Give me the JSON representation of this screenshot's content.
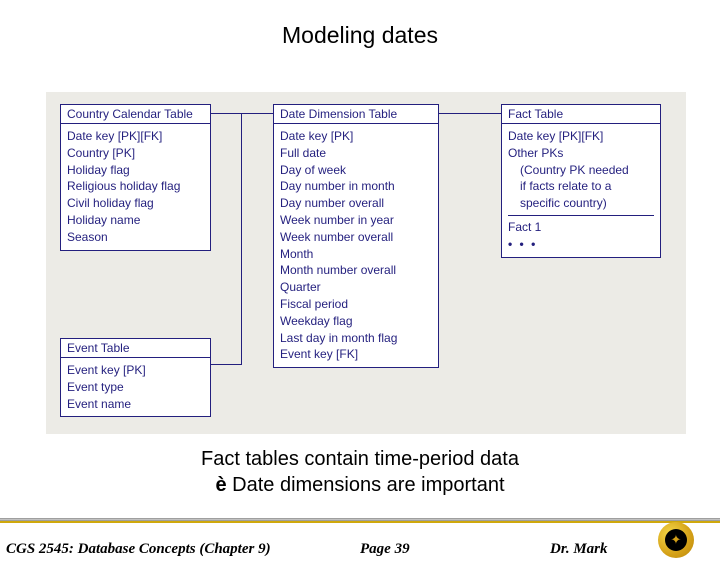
{
  "title": "Modeling dates",
  "tables": {
    "country_calendar": {
      "header": "Country Calendar Table",
      "fields": [
        "Date key [PK][FK]",
        "Country [PK]",
        "Holiday flag",
        "Religious holiday flag",
        "Civil holiday flag",
        "Holiday name",
        "Season"
      ]
    },
    "date_dimension": {
      "header": "Date Dimension Table",
      "fields": [
        "Date key [PK]",
        "Full date",
        "Day of week",
        "Day number in month",
        "Day number overall",
        "Week number in year",
        "Week number overall",
        "Month",
        "Month number overall",
        "Quarter",
        "Fiscal period",
        "Weekday flag",
        "Last day in month flag",
        "Event key [FK]"
      ]
    },
    "fact": {
      "header": "Fact Table",
      "fields_top": [
        "Date key [PK][FK]",
        "Other PKs"
      ],
      "note_line1": "(Country PK needed",
      "note_line2": "if facts relate to a",
      "note_line3": "specific country)",
      "fields_bottom": [
        "Fact 1"
      ],
      "ellipsis": "• • •"
    },
    "event": {
      "header": "Event Table",
      "fields": [
        "Event key [PK]",
        "Event type",
        "Event name"
      ]
    }
  },
  "caption": {
    "line1": "Fact tables contain time-period data",
    "arrow": "è",
    "line2": " Date dimensions are important"
  },
  "footer": {
    "left": "CGS 2545: Database Concepts  (Chapter 9)",
    "center": "Page 39",
    "right": "Dr. Mark"
  }
}
